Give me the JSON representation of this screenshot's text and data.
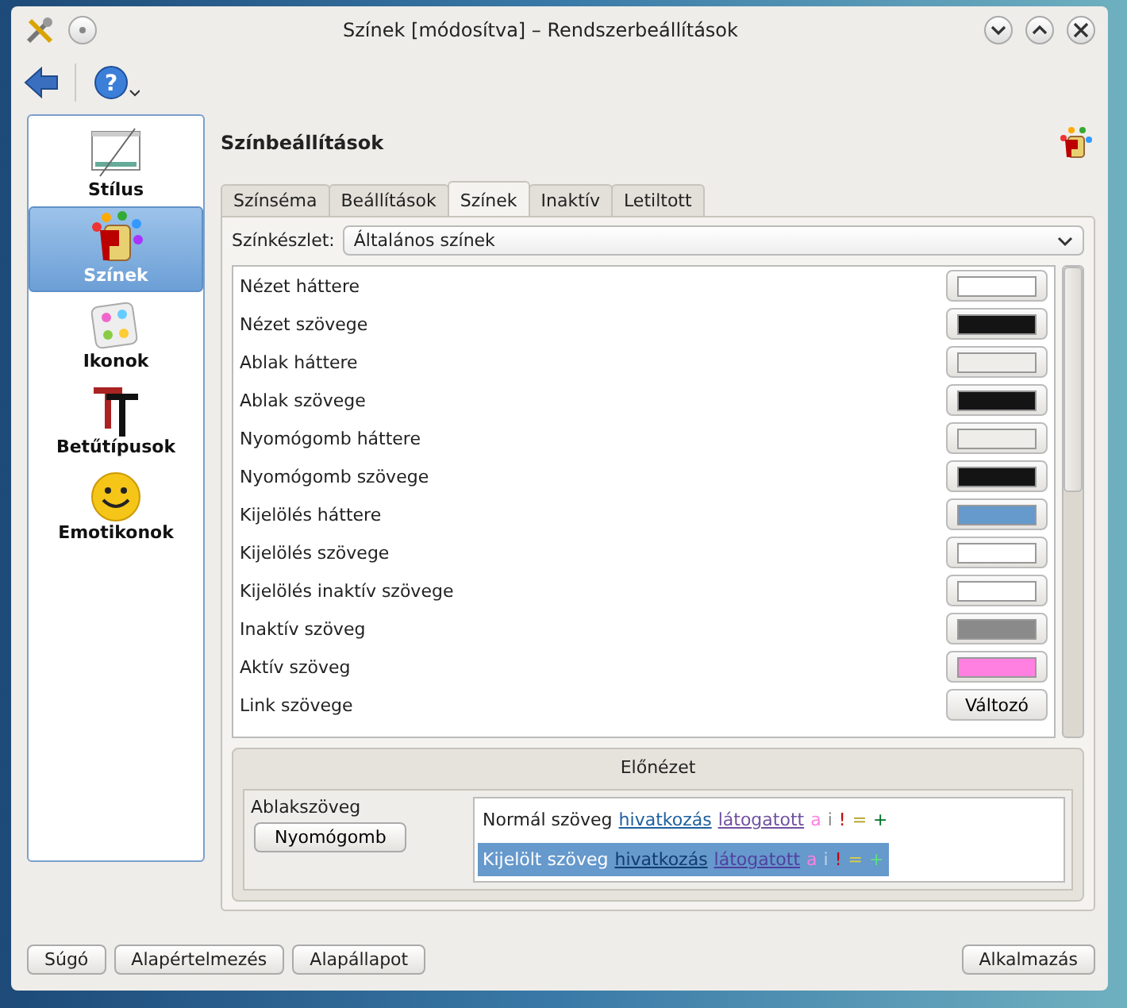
{
  "window": {
    "title": "Színek [módosítva] – Rendszerbeállítások"
  },
  "sidebar": {
    "items": [
      {
        "label": "Stílus",
        "kind": "style",
        "selected": false
      },
      {
        "label": "Színek",
        "kind": "colors",
        "selected": true
      },
      {
        "label": "Ikonok",
        "kind": "icons",
        "selected": false
      },
      {
        "label": "Betűtípusok",
        "kind": "fonts",
        "selected": false
      },
      {
        "label": "Emotikonok",
        "kind": "emoticons",
        "selected": false
      }
    ]
  },
  "toolbar": {
    "help_glyph": "?"
  },
  "heading": "Színbeállítások",
  "tabs": [
    {
      "label": "Színséma",
      "selected": false
    },
    {
      "label": "Beállítások",
      "selected": false
    },
    {
      "label": "Színek",
      "selected": true
    },
    {
      "label": "Inaktív",
      "selected": false
    },
    {
      "label": "Letiltott",
      "selected": false
    }
  ],
  "color_set": {
    "label": "Színkészlet:",
    "value": "Általános színek"
  },
  "color_rows": [
    {
      "label": "Nézet háttere",
      "kind": "swatch",
      "color": "#ffffff"
    },
    {
      "label": "Nézet szövege",
      "kind": "swatch",
      "color": "#141414"
    },
    {
      "label": "Ablak háttere",
      "kind": "swatch",
      "color": "#efede9"
    },
    {
      "label": "Ablak szövege",
      "kind": "swatch",
      "color": "#141414"
    },
    {
      "label": "Nyomógomb háttere",
      "kind": "swatch",
      "color": "#efede9"
    },
    {
      "label": "Nyomógomb szövege",
      "kind": "swatch",
      "color": "#141414"
    },
    {
      "label": "Kijelölés háttere",
      "kind": "swatch",
      "color": "#6699cc"
    },
    {
      "label": "Kijelölés szövege",
      "kind": "swatch",
      "color": "#ffffff"
    },
    {
      "label": "Kijelölés inaktív szövege",
      "kind": "swatch",
      "color": "#ffffff"
    },
    {
      "label": "Inaktív szöveg",
      "kind": "swatch",
      "color": "#8a8a8a"
    },
    {
      "label": "Aktív szöveg",
      "kind": "swatch",
      "color": "#ff80e0"
    },
    {
      "label": "Link szövege",
      "kind": "varying",
      "button": "Változó"
    }
  ],
  "preview": {
    "title": "Előnézet",
    "window_text": "Ablakszöveg",
    "push_button": "Nyomógomb",
    "lines": [
      {
        "selected": false,
        "parts": [
          {
            "text": "Normál szöveg",
            "kind": "plain"
          },
          {
            "text": "hivatkozás",
            "kind": "link",
            "color": "#2060a0"
          },
          {
            "text": "látogatott",
            "kind": "link",
            "color": "#7050a0"
          },
          {
            "text": "a",
            "kind": "plain",
            "color": "#ff80e0"
          },
          {
            "text": "i",
            "kind": "plain",
            "color": "#8a8a8a"
          },
          {
            "text": "!",
            "kind": "plain",
            "color": "#bf0303"
          },
          {
            "text": "=",
            "kind": "plain",
            "color": "#b0a020"
          },
          {
            "text": "+",
            "kind": "plain",
            "color": "#006e28"
          }
        ]
      },
      {
        "selected": true,
        "parts": [
          {
            "text": "Kijelölt szöveg",
            "kind": "plain"
          },
          {
            "text": "hivatkozás",
            "kind": "link",
            "color": "#103c70"
          },
          {
            "text": "látogatott",
            "kind": "link",
            "color": "#5040a0"
          },
          {
            "text": "a",
            "kind": "plain",
            "color": "#ff80e0"
          },
          {
            "text": "i",
            "kind": "plain",
            "color": "#c0d0e0"
          },
          {
            "text": "!",
            "kind": "plain",
            "color": "#bf0303"
          },
          {
            "text": "=",
            "kind": "plain",
            "color": "#e0d040"
          },
          {
            "text": "+",
            "kind": "plain",
            "color": "#60e080"
          }
        ]
      }
    ]
  },
  "footer": {
    "left": [
      "Súgó",
      "Alapértelmezés",
      "Alapállapot"
    ],
    "right": [
      "Alkalmazás"
    ]
  }
}
